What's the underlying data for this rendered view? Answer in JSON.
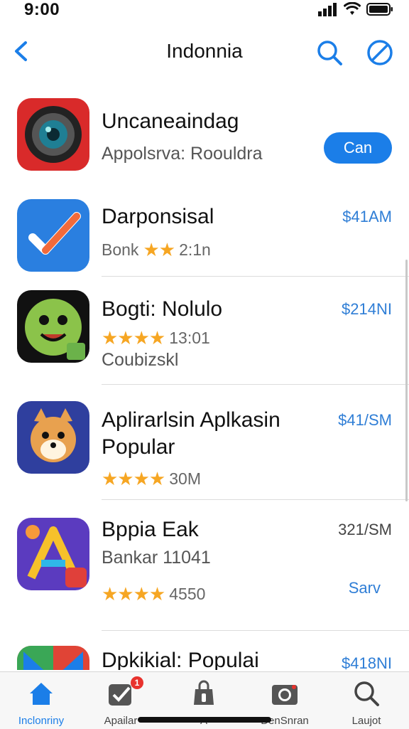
{
  "status_bar": {
    "time": "9:00",
    "icons": [
      "cellular-icon",
      "wifi-icon",
      "battery-icon"
    ]
  },
  "navbar": {
    "title": "Indonnia",
    "back_icon": "chevron-left-icon",
    "search_icon": "search-icon",
    "block_icon": "block-icon"
  },
  "apps": [
    {
      "name": "Uncaneaindag",
      "subtitle": "Appolsrva:  Roouldra",
      "action": "Can",
      "icon": "camera-lens-icon",
      "icon_color": "#d92a2a"
    },
    {
      "name": "Darponsisal",
      "subtitle": "Bonk",
      "rating_text": "2:1n",
      "price": "$41AM",
      "icon": "checkmark-icon",
      "icon_color": "#2a7fe0"
    },
    {
      "name": "Bogti: Nolulo",
      "rating_text": "13:01",
      "subtitle": "Coubizskl",
      "price": "$214NI",
      "icon": "green-monster-icon",
      "icon_color": "#8bc34a",
      "rating": 4.5
    },
    {
      "name": "Aplirarlsin Aplkasin",
      "name2": "Popular",
      "rating_text": "30M",
      "price": "$41/SM",
      "icon": "cartoon-dog-icon",
      "icon_color": "#e8a14f",
      "rating": 4.5
    },
    {
      "name": "Bppia Eak",
      "subtitle": "Bankar 11041",
      "rating_text": "4550",
      "price": "321/SM",
      "action": "Sarv",
      "icon": "colorful-a-icon",
      "icon_color": "#5b3bbf",
      "rating": 4.5
    },
    {
      "name": "Dpkikial: Populai",
      "price": "$418NI",
      "icon": "m-logo-icon",
      "icon_color": "#e04436"
    }
  ],
  "tabs": [
    {
      "label": "Inclonriny",
      "icon": "home-icon",
      "active": true
    },
    {
      "label": "Apailar",
      "icon": "checkmark-box-icon",
      "badge": "1"
    },
    {
      "label": "A",
      "icon": "bag-icon"
    },
    {
      "label": "DenSnran",
      "icon": "camera-icon"
    },
    {
      "label": "Laujot",
      "icon": "search-icon"
    }
  ]
}
